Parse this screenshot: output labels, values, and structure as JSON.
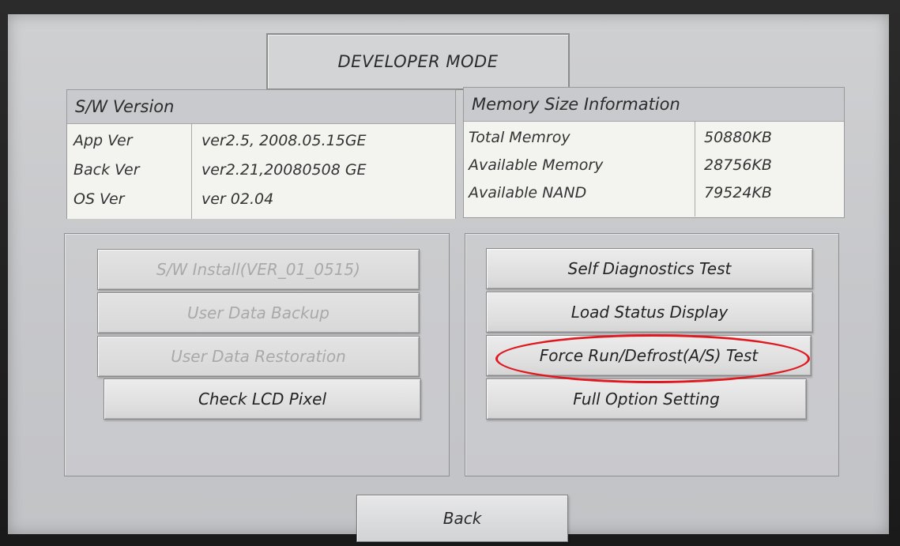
{
  "header": {
    "title": "DEVELOPER MODE"
  },
  "software_version": {
    "heading": "S/W Version",
    "rows": [
      {
        "label": "App Ver",
        "value": "ver2.5, 2008.05.15GE"
      },
      {
        "label": "Back Ver",
        "value": "ver2.21,20080508 GE"
      },
      {
        "label": "OS Ver",
        "value": "ver 02.04"
      }
    ]
  },
  "memory": {
    "heading": "Memory Size Information",
    "rows": [
      {
        "label": "Total Memroy",
        "value": "50880KB"
      },
      {
        "label": "Available Memory",
        "value": "28756KB"
      },
      {
        "label": "Available NAND",
        "value": "79524KB"
      }
    ]
  },
  "left_buttons": [
    {
      "label": "S/W Install(VER_01_0515)",
      "enabled": false
    },
    {
      "label": "User Data Backup",
      "enabled": false
    },
    {
      "label": "User Data Restoration",
      "enabled": false
    },
    {
      "label": "Check LCD Pixel",
      "enabled": true
    }
  ],
  "right_buttons": [
    {
      "label": "Self Diagnostics Test",
      "enabled": true
    },
    {
      "label": "Load Status Display",
      "enabled": true
    },
    {
      "label": "Force Run/Defrost(A/S) Test",
      "enabled": true,
      "highlighted": true
    },
    {
      "label": "Full Option Setting",
      "enabled": true
    }
  ],
  "footer": {
    "back_label": "Back"
  },
  "colors": {
    "highlight_ring": "#e0181f",
    "disabled_text": "#a9a9a9"
  }
}
